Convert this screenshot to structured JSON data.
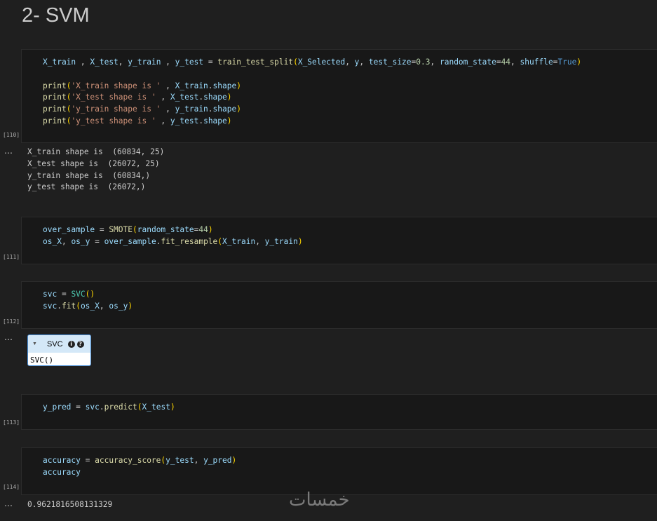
{
  "heading": "2- SVM",
  "cells": [
    {
      "exec_count": "[110]",
      "lines": [
        [
          [
            "v",
            "X_train"
          ],
          [
            "p",
            " , "
          ],
          [
            "v",
            "X_test"
          ],
          [
            "p",
            ", "
          ],
          [
            "v",
            "y_train"
          ],
          [
            "p",
            " , "
          ],
          [
            "v",
            "y_test"
          ],
          [
            "p",
            " = "
          ],
          [
            "f",
            "train_test_split"
          ],
          [
            "b1",
            "("
          ],
          [
            "v",
            "X_Selected"
          ],
          [
            "p",
            ", "
          ],
          [
            "v",
            "y"
          ],
          [
            "p",
            ", "
          ],
          [
            "v",
            "test_size"
          ],
          [
            "p",
            "="
          ],
          [
            "n",
            "0.3"
          ],
          [
            "p",
            ", "
          ],
          [
            "v",
            "random_state"
          ],
          [
            "p",
            "="
          ],
          [
            "n",
            "44"
          ],
          [
            "p",
            ", "
          ],
          [
            "v",
            "shuffle"
          ],
          [
            "p",
            "="
          ],
          [
            "k",
            "True"
          ],
          [
            "b1",
            ")"
          ]
        ],
        [],
        [
          [
            "f",
            "print"
          ],
          [
            "b1",
            "("
          ],
          [
            "s",
            "'X_train shape is '"
          ],
          [
            "p",
            " , "
          ],
          [
            "v",
            "X_train"
          ],
          [
            "p",
            "."
          ],
          [
            "v",
            "shape"
          ],
          [
            "b1",
            ")"
          ]
        ],
        [
          [
            "f",
            "print"
          ],
          [
            "b1",
            "("
          ],
          [
            "s",
            "'X_test shape is '"
          ],
          [
            "p",
            " , "
          ],
          [
            "v",
            "X_test"
          ],
          [
            "p",
            "."
          ],
          [
            "v",
            "shape"
          ],
          [
            "b1",
            ")"
          ]
        ],
        [
          [
            "f",
            "print"
          ],
          [
            "b1",
            "("
          ],
          [
            "s",
            "'y_train shape is '"
          ],
          [
            "p",
            " , "
          ],
          [
            "v",
            "y_train"
          ],
          [
            "p",
            "."
          ],
          [
            "v",
            "shape"
          ],
          [
            "b1",
            ")"
          ]
        ],
        [
          [
            "f",
            "print"
          ],
          [
            "b1",
            "("
          ],
          [
            "s",
            "'y_test shape is '"
          ],
          [
            "p",
            " , "
          ],
          [
            "v",
            "y_test"
          ],
          [
            "p",
            "."
          ],
          [
            "v",
            "shape"
          ],
          [
            "b1",
            ")"
          ]
        ]
      ]
    },
    {
      "exec_count": "[111]",
      "lines": [
        [
          [
            "v",
            "over_sample"
          ],
          [
            "p",
            " = "
          ],
          [
            "f",
            "SMOTE"
          ],
          [
            "b1",
            "("
          ],
          [
            "v",
            "random_state"
          ],
          [
            "p",
            "="
          ],
          [
            "n",
            "44"
          ],
          [
            "b1",
            ")"
          ]
        ],
        [
          [
            "v",
            "os_X"
          ],
          [
            "p",
            ", "
          ],
          [
            "v",
            "os_y"
          ],
          [
            "p",
            " = "
          ],
          [
            "v",
            "over_sample"
          ],
          [
            "p",
            "."
          ],
          [
            "f",
            "fit_resample"
          ],
          [
            "b1",
            "("
          ],
          [
            "v",
            "X_train"
          ],
          [
            "p",
            ", "
          ],
          [
            "v",
            "y_train"
          ],
          [
            "b1",
            ")"
          ]
        ]
      ]
    },
    {
      "exec_count": "[112]",
      "lines": [
        [
          [
            "v",
            "svc"
          ],
          [
            "p",
            " = "
          ],
          [
            "c",
            "SVC"
          ],
          [
            "b1",
            "()"
          ]
        ],
        [
          [
            "v",
            "svc"
          ],
          [
            "p",
            "."
          ],
          [
            "f",
            "fit"
          ],
          [
            "b1",
            "("
          ],
          [
            "v",
            "os_X"
          ],
          [
            "p",
            ", "
          ],
          [
            "v",
            "os_y"
          ],
          [
            "b1",
            ")"
          ]
        ]
      ]
    },
    {
      "exec_count": "[113]",
      "lines": [
        [
          [
            "v",
            "y_pred"
          ],
          [
            "p",
            " = "
          ],
          [
            "v",
            "svc"
          ],
          [
            "p",
            "."
          ],
          [
            "f",
            "predict"
          ],
          [
            "b1",
            "("
          ],
          [
            "v",
            "X_test"
          ],
          [
            "b1",
            ")"
          ]
        ]
      ]
    },
    {
      "exec_count": "[114]",
      "lines": [
        [
          [
            "v",
            "accuracy"
          ],
          [
            "p",
            " = "
          ],
          [
            "f",
            "accuracy_score"
          ],
          [
            "b1",
            "("
          ],
          [
            "v",
            "y_test"
          ],
          [
            "p",
            ", "
          ],
          [
            "v",
            "y_pred"
          ],
          [
            "b1",
            ")"
          ]
        ],
        [
          [
            "v",
            "accuracy"
          ]
        ]
      ]
    }
  ],
  "outputs": {
    "out110": "X_train shape is  (60834, 25)\nX_test shape is  (26072, 25)\ny_train shape is  (60834,)\ny_test shape is  (26072,)",
    "out114": "0.9621816508131329",
    "more_icon": "…"
  },
  "svc_widget": {
    "arrow_icon": "▼",
    "name": "SVC",
    "info_icon": "i",
    "help_icon": "?",
    "repr": "SVC()"
  },
  "watermark": "خمسات"
}
